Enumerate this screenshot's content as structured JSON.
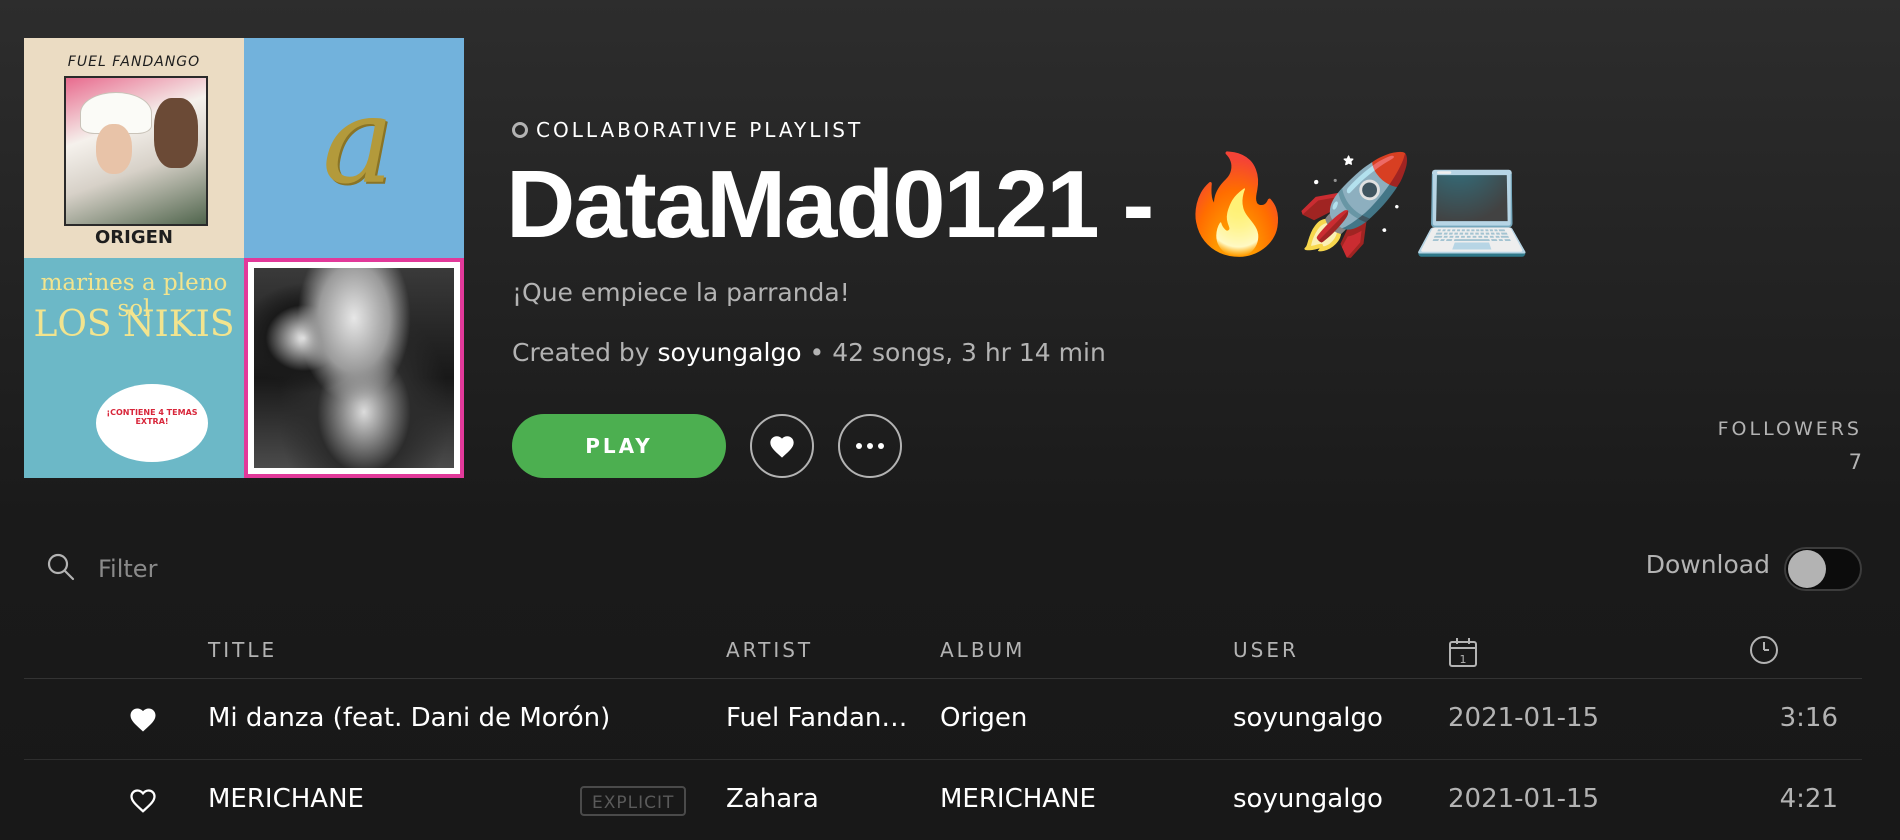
{
  "cover": {
    "tile1_title": "FUEL FANDANGO",
    "tile1_caption": "ORIGEN",
    "tile2_glyph": "a",
    "tile3_line1": "marines a pleno sol",
    "tile3_line2": "LOS NIKIS",
    "tile3_burst": "¡CONTIENE 4 TEMAS EXTRA!",
    "accent_border": "#e2399a"
  },
  "header": {
    "kind": "COLLABORATIVE PLAYLIST",
    "title": "DataMad0121 - 🔥🚀💻",
    "description": "¡Que empiece la parranda!",
    "created_by_prefix": "Created by ",
    "owner": "soyungalgo",
    "stats": " • 42 songs, 3 hr 14 min"
  },
  "actions": {
    "play_label": "PLAY",
    "play_color": "#4caf50",
    "like_icon": "heart-icon",
    "more_icon": "ellipsis-icon"
  },
  "followers": {
    "label": "FOLLOWERS",
    "count": "7"
  },
  "filter": {
    "placeholder": "Filter",
    "value": ""
  },
  "download": {
    "label": "Download",
    "enabled": false
  },
  "table": {
    "columns": {
      "title": "TITLE",
      "artist": "ARTIST",
      "album": "ALBUM",
      "user": "USER",
      "date_icon": "calendar-icon",
      "duration_icon": "clock-icon"
    },
    "rows": [
      {
        "liked": true,
        "title": "Mi danza (feat. Dani de Morón)",
        "explicit": "",
        "artist": "Fuel Fandan…",
        "album": "Origen",
        "user": "soyungalgo",
        "date": "2021-01-15",
        "duration": "3:16"
      },
      {
        "liked": false,
        "title": "MERICHANE",
        "explicit": "EXPLICIT",
        "artist": "Zahara",
        "album": "MERICHANE",
        "user": "soyungalgo",
        "date": "2021-01-15",
        "duration": "4:21"
      }
    ]
  }
}
